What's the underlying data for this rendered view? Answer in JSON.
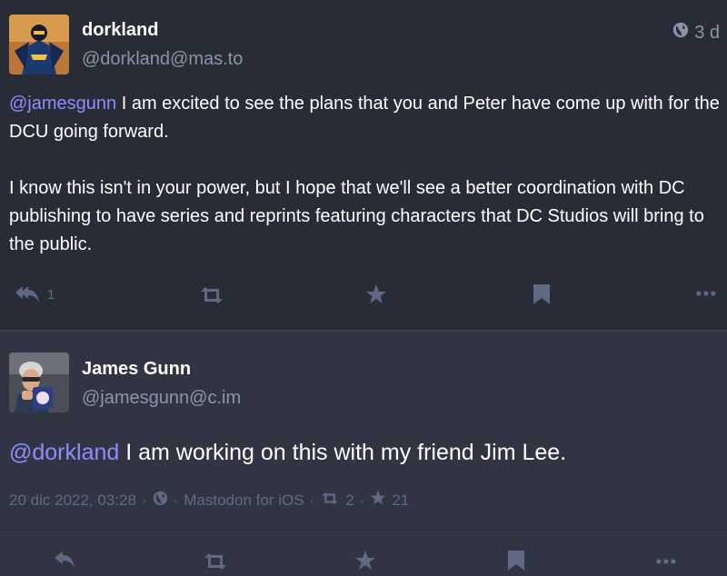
{
  "post1": {
    "display_name": "dorkland",
    "handle": "@dorkland@mas.to",
    "time": "3 d",
    "mention": "@jamesgunn",
    "paragraph1_rest": " I am excited to see the plans that you and Peter have come up with for the DCU going forward.",
    "paragraph2": "I know this isn't in your power, but I hope that we'll see a better coordination with DC publishing to have series and reprints featuring characters that DC Studios will bring to the public.",
    "reply_count": "1"
  },
  "post2": {
    "display_name": "James Gunn",
    "handle": "@jamesgunn@c.im",
    "mention": "@dorkland",
    "text_rest": " I am working on this with my friend Jim Lee.",
    "date": "20 dic 2022, 03:28",
    "app": "Mastodon for iOS",
    "boost_count": "2",
    "fav_count": "21"
  },
  "icons": {
    "globe": "globe-icon",
    "reply": "reply-icon",
    "boost": "boost-icon",
    "favourite": "star-icon",
    "bookmark": "bookmark-icon",
    "more": "ellipsis-icon"
  },
  "colors": {
    "background": "#282c37",
    "focused_background": "#313543",
    "muted_text": "#8c93ab",
    "icon": "#606984",
    "mention": "#8c8dff"
  }
}
